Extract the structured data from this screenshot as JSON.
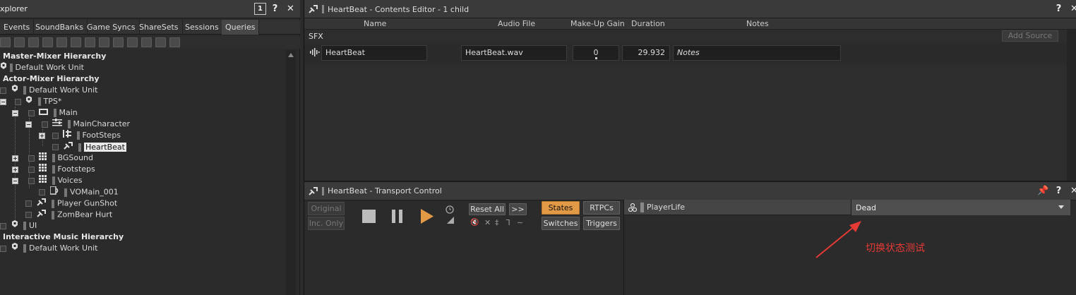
{
  "explorer": {
    "title": "xplorer",
    "tabs": [
      "Events",
      "SoundBanks",
      "Game Syncs",
      "ShareSets",
      "Sessions",
      "Queries"
    ],
    "tree": [
      {
        "label": "Master-Mixer Hierarchy",
        "kind": "section"
      },
      {
        "label": "Default Work Unit",
        "kind": "workunit"
      },
      {
        "label": "Actor-Mixer Hierarchy",
        "kind": "section"
      },
      {
        "label": "Default Work Unit",
        "kind": "workunit"
      },
      {
        "label": "TPS*",
        "kind": "workunit"
      },
      {
        "label": "Main",
        "kind": "folder"
      },
      {
        "label": "MainCharacter",
        "kind": "actor-mixer"
      },
      {
        "label": "FootSteps",
        "kind": "switch-container"
      },
      {
        "label": "HeartBeat",
        "kind": "sound",
        "selected": true
      },
      {
        "label": "BGSound",
        "kind": "random-container"
      },
      {
        "label": "Footsteps",
        "kind": "random-container"
      },
      {
        "label": "Voices",
        "kind": "random-container"
      },
      {
        "label": "VOMain_001",
        "kind": "voice"
      },
      {
        "label": "Player GunShot",
        "kind": "sound"
      },
      {
        "label": "ZomBear Hurt",
        "kind": "sound"
      },
      {
        "label": "UI",
        "kind": "workunit"
      },
      {
        "label": "Interactive Music Hierarchy",
        "kind": "section"
      },
      {
        "label": "Default Work Unit",
        "kind": "workunit"
      }
    ]
  },
  "contents_editor": {
    "title": "HeartBeat - Contents Editor - 1 child",
    "columns": {
      "name": "Name",
      "audio_file": "Audio File",
      "makeup_gain": "Make-Up Gain",
      "duration": "Duration",
      "notes": "Notes"
    },
    "group_label": "SFX",
    "add_source": "Add Source >>",
    "row": {
      "name": "HeartBeat",
      "audio_file": "HeartBeat.wav",
      "makeup_gain": "0",
      "duration": "29.932",
      "notes": "Notes"
    }
  },
  "transport": {
    "title": "HeartBeat - Transport Control",
    "original": "Original",
    "inc_only": "Inc. Only",
    "reset_all": "Reset All",
    "more": ">>",
    "tabs": {
      "states": "States",
      "rtpcs": "RTPCs",
      "switches": "Switches",
      "triggers": "Triggers"
    },
    "state_group": "PlayerLife",
    "state_value": "Dead",
    "annotation": "切换状态测试"
  },
  "colors": {
    "accent_orange": "#e39a46",
    "annotation_red": "#e53935"
  }
}
